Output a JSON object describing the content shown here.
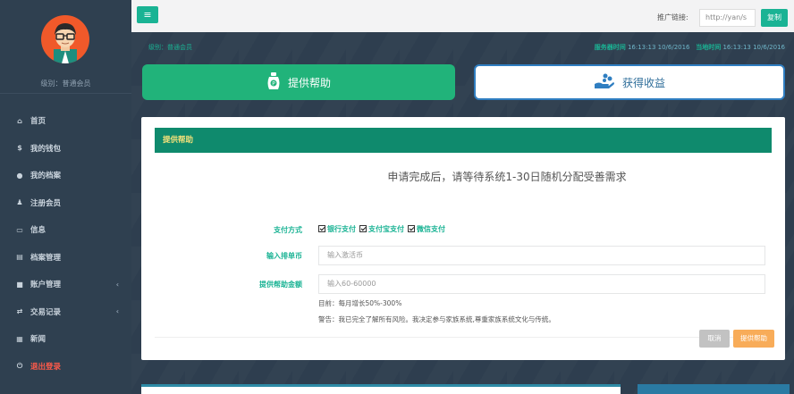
{
  "sidebar": {
    "user_level": "级别：普通会员",
    "items": [
      {
        "label": "首页",
        "icon": "home-icon",
        "glyph": "⌂"
      },
      {
        "label": "我的钱包",
        "icon": "dollar-icon",
        "glyph": "$"
      },
      {
        "label": "我的档案",
        "icon": "user-icon",
        "glyph": "●"
      },
      {
        "label": "注册会员",
        "icon": "male-icon",
        "glyph": "♟"
      },
      {
        "label": "信息",
        "icon": "folder-icon",
        "glyph": "▭"
      },
      {
        "label": "档案管理",
        "icon": "card-icon",
        "glyph": "▤"
      },
      {
        "label": "账户管理",
        "icon": "lock-icon",
        "glyph": "■",
        "chevron": "‹"
      },
      {
        "label": "交易记录",
        "icon": "exchange-icon",
        "glyph": "⇄",
        "chevron": "‹"
      },
      {
        "label": "新闻",
        "icon": "newspaper-icon",
        "glyph": "▦"
      },
      {
        "label": "退出登录",
        "icon": "power-icon",
        "glyph": "⏻"
      }
    ]
  },
  "topbar": {
    "menu_glyph": "≡",
    "promo_label": "推广链接:",
    "promo_value": "http://yan/s",
    "copy_label": "复制"
  },
  "main": {
    "level_text": "级别：普通会员",
    "server_time_label": "服务器时间",
    "server_time": "16:13:13 10/6/2016",
    "local_time_label": "当地时间",
    "local_time": "16:13:13 10/6/2016",
    "help_label": "提供帮助",
    "gain_label": "获得收益"
  },
  "panel": {
    "title": "提供帮助",
    "notice": "申请完成后，请等待系统1-30日随机分配受善需求",
    "payment_label": "支付方式",
    "payment_options": [
      "银行支付",
      "支付宝支付",
      "微信支付"
    ],
    "code_label": "输入排单币",
    "code_placeholder": "输入激活币",
    "amount_label": "提供帮助金额",
    "amount_placeholder": "输入60-60000",
    "hint_growth": "目前：每月增长50%-300%",
    "hint_warning": "警告：我已完全了解所有风险。我决定参与家族系统,尊重家族系统文化与传统。",
    "cancel_label": "取消",
    "submit_label": "提供帮助"
  },
  "colors": {
    "accent": "#1ab394",
    "sidebar_bg": "#2f4050",
    "panel_head": "#0f8a6d",
    "help_btn": "#21b37a",
    "submit": "#f8ac59"
  }
}
